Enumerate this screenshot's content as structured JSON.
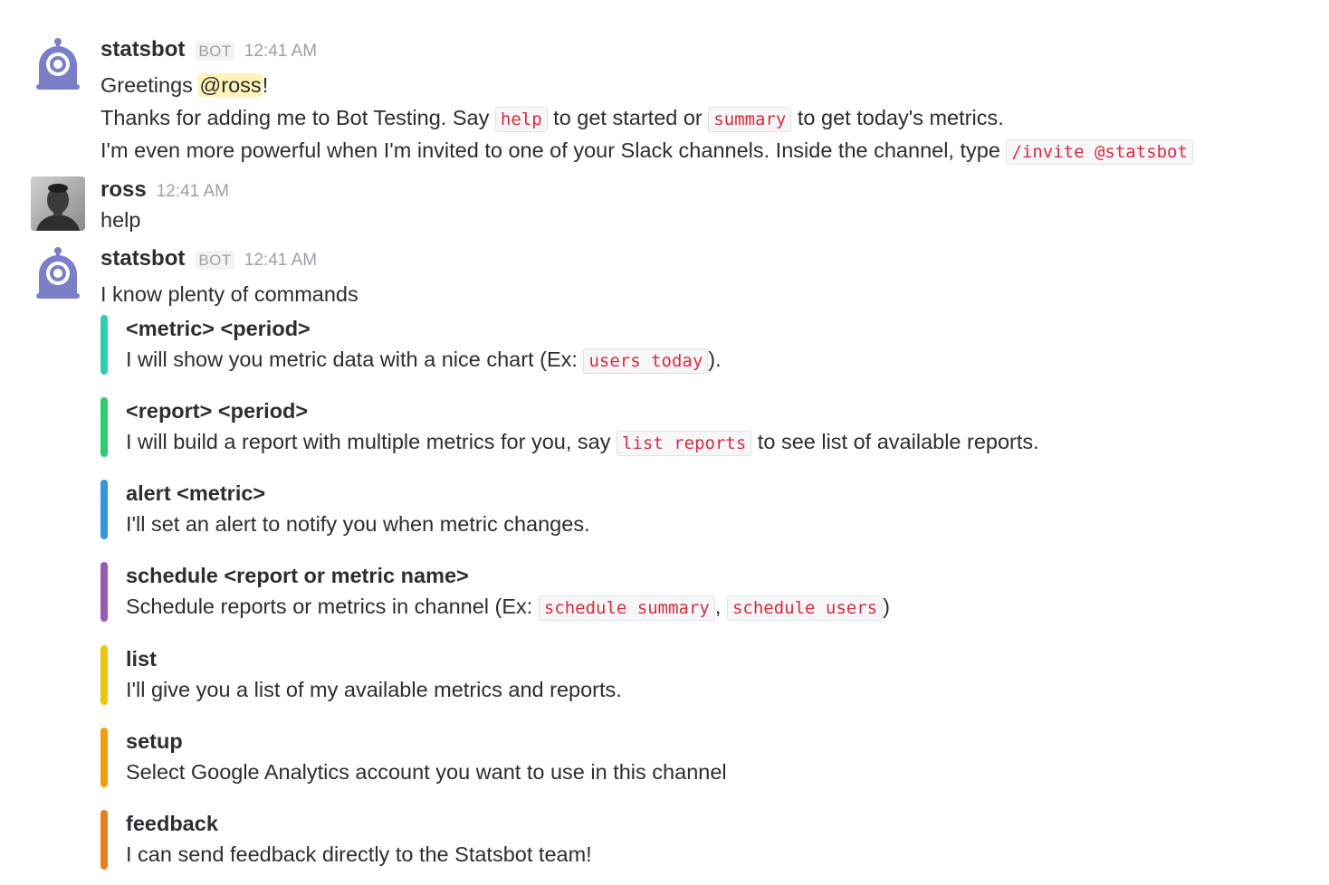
{
  "messages": [
    {
      "sender": "statsbot",
      "badge": "BOT",
      "time": "12:41 AM",
      "greeting_prefix": "Greetings ",
      "mention": "@ross",
      "greeting_suffix": "!",
      "line2": {
        "t1": "Thanks for adding me to Bot Testing. Say ",
        "code1": "help",
        "t2": " to get started or ",
        "code2": "summary",
        "t3": " to get today's metrics."
      },
      "line3": {
        "t1": "I'm even more powerful when I'm invited to one of your Slack channels. Inside the channel, type ",
        "code1": "/invite @statsbot"
      }
    },
    {
      "sender": "ross",
      "time": "12:41 AM",
      "text": "help"
    },
    {
      "sender": "statsbot",
      "badge": "BOT",
      "time": "12:41 AM",
      "intro": "I know plenty of commands",
      "attachments": [
        {
          "color": "#2ecfb1",
          "title": "<metric> <period>",
          "t1": "I will show you metric data with a nice chart (Ex: ",
          "code1": "users today",
          "t2": ")."
        },
        {
          "color": "#2ecc71",
          "title": "<report> <period>",
          "t1": "I will build a report with multiple metrics for you, say ",
          "code1": "list reports",
          "t2": " to see list of available reports."
        },
        {
          "color": "#3498db",
          "title": "alert <metric>",
          "t1": "I'll set an alert to notify you when metric changes."
        },
        {
          "color": "#9b59b6",
          "title": "schedule <report or metric name>",
          "t1": "Schedule reports or metrics in channel (Ex: ",
          "code1": "schedule summary",
          "t2": ", ",
          "code2": "schedule users",
          "t3": ")"
        },
        {
          "color": "#f1c40f",
          "title": "list",
          "t1": "I'll give you a list of my available metrics and reports."
        },
        {
          "color": "#f39c12",
          "title": "setup",
          "t1": "Select Google Analytics account you want to use in this channel"
        },
        {
          "color": "#e67e22",
          "title": "feedback",
          "t1": "I can send feedback directly to the Statsbot team!"
        }
      ]
    }
  ],
  "colors": {
    "bot_avatar": "#7a7fc8",
    "mention_bg": "#fff3b8",
    "code_text": "#d72b3f"
  },
  "icons": {
    "bot_avatar": "robot-eye-icon",
    "user_avatar": "user-photo"
  }
}
